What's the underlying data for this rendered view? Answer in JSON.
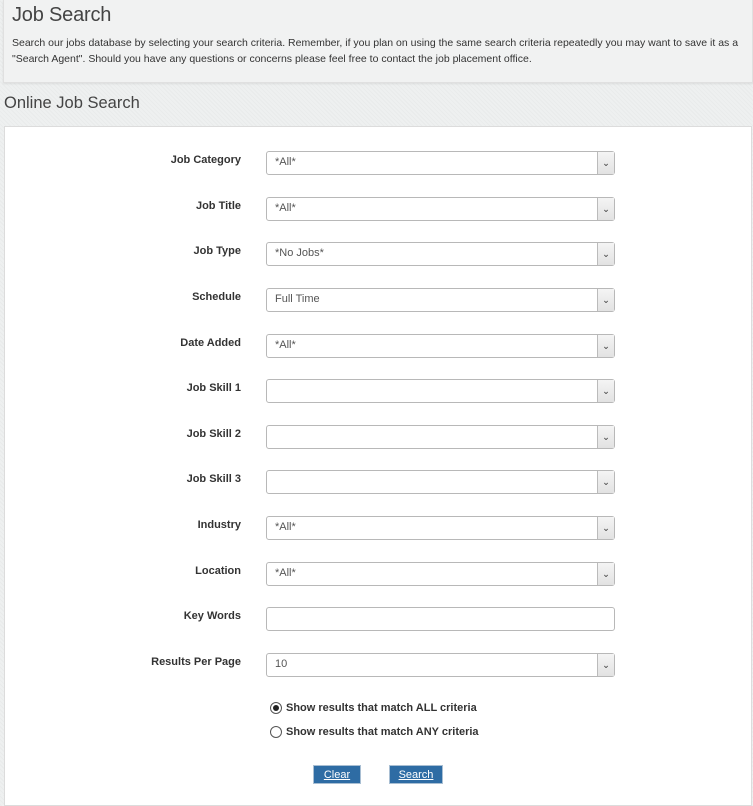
{
  "header": {
    "title": "Job Search",
    "description": "Search our jobs database by selecting your search criteria. Remember, if you plan on using the same search criteria repeatedly you may want to save it as a \"Search Agent\". Should you have any questions or concerns please feel free to contact the job placement office."
  },
  "section": {
    "title": "Online Job Search"
  },
  "form": {
    "fields": [
      {
        "label": "Job Category",
        "type": "select",
        "value": "*All*"
      },
      {
        "label": "Job Title",
        "type": "select",
        "value": "*All*"
      },
      {
        "label": "Job Type",
        "type": "select",
        "value": "*No Jobs*"
      },
      {
        "label": "Schedule",
        "type": "select",
        "value": "Full Time"
      },
      {
        "label": "Date Added",
        "type": "select",
        "value": "*All*"
      },
      {
        "label": "Job Skill 1",
        "type": "select",
        "value": ""
      },
      {
        "label": "Job Skill 2",
        "type": "select",
        "value": ""
      },
      {
        "label": "Job Skill 3",
        "type": "select",
        "value": ""
      },
      {
        "label": "Industry",
        "type": "select",
        "value": "*All*"
      },
      {
        "label": "Location",
        "type": "select",
        "value": "*All*"
      },
      {
        "label": "Key Words",
        "type": "text",
        "value": ""
      },
      {
        "label": "Results Per Page",
        "type": "select",
        "value": "10"
      }
    ],
    "match_options": [
      {
        "label": "Show results that match ALL criteria",
        "checked": true
      },
      {
        "label": "Show results that match ANY criteria",
        "checked": false
      }
    ],
    "buttons": {
      "clear": "Clear",
      "search": "Search"
    },
    "dropdown_arrow_icon": "chevron-down-icon",
    "dropdown_arrow_glyph": "⌵"
  }
}
